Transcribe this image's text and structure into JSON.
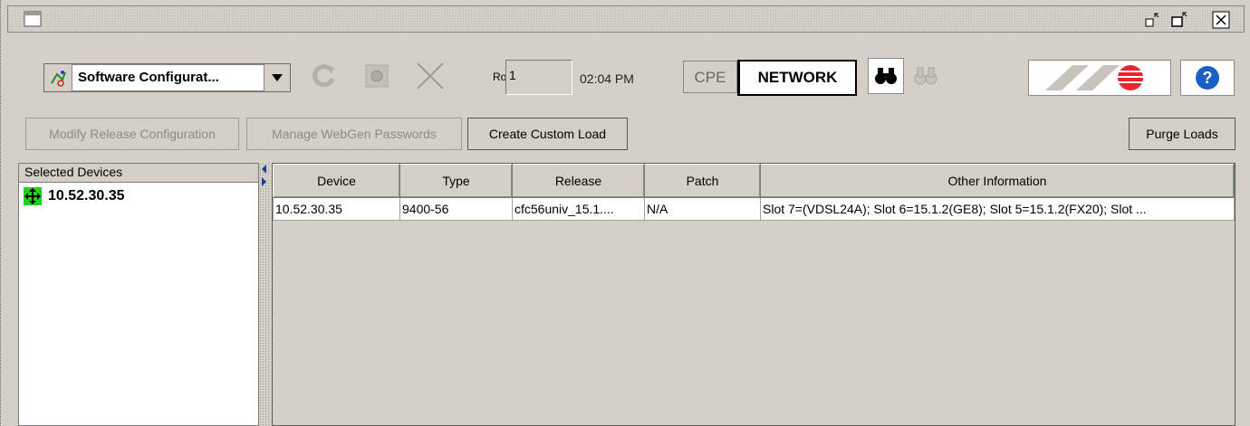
{
  "toolbar": {
    "module_select": {
      "value": "Software Configurat..."
    },
    "rows_label": "Rows",
    "rows_value": "1",
    "time": "02:04 PM",
    "cpe_label": "CPE",
    "network_label": "NETWORK"
  },
  "actions": {
    "modify_release": "Modify Release Configuration",
    "manage_webgen": "Manage WebGen Passwords",
    "create_custom_load": "Create Custom Load",
    "purge_loads": "Purge Loads"
  },
  "left_panel": {
    "header": "Selected Devices",
    "devices": [
      {
        "label": "10.52.30.35"
      }
    ]
  },
  "table": {
    "columns": [
      "Device",
      "Type",
      "Release",
      "Patch",
      "Other Information"
    ],
    "rows": [
      [
        "10.52.30.35",
        "9400-56",
        "cfc56univ_15.1....",
        "N/A",
        "Slot 7=(VDSL24A); Slot 6=15.1.2(GE8); Slot 5=15.1.2(FX20); Slot ..."
      ]
    ]
  },
  "colors": {
    "logo_red": "#e8242c",
    "device_icon_green": "#22d022",
    "help_blue": "#1c5fc9"
  }
}
